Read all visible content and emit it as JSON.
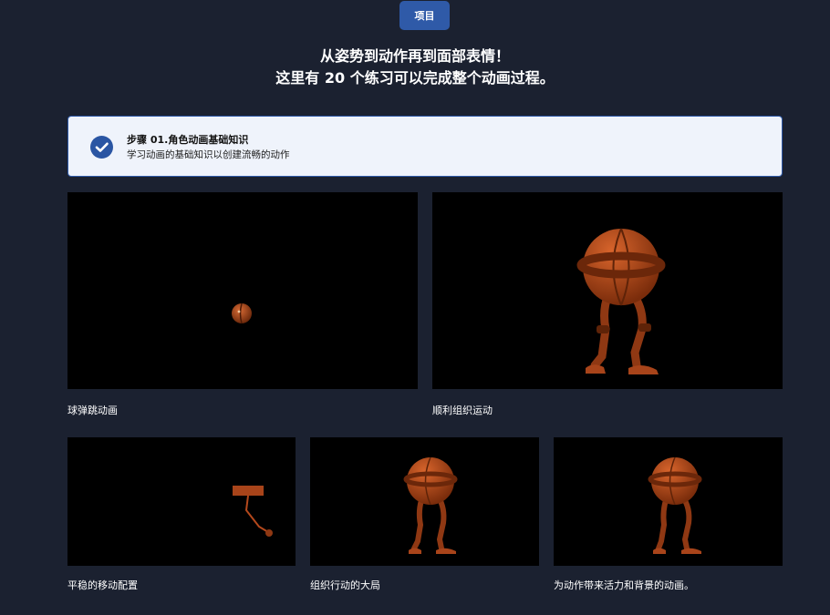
{
  "top_tab": {
    "label": "项目"
  },
  "headline": {
    "line1": "从姿势到动作再到面部表情！",
    "line2": "这里有 20 个练习可以完成整个动画过程。"
  },
  "step": {
    "title": "步骤 01.角色动画基础知识",
    "subtitle": "学习动画的基础知识以创建流畅的动作"
  },
  "lessons": [
    {
      "caption": "球弹跳动画"
    },
    {
      "caption": "顺利组织运动"
    },
    {
      "caption": "平稳的移动配置"
    },
    {
      "caption": "组织行动的大局"
    },
    {
      "caption": "为动作带来活力和背景的动画。"
    }
  ],
  "colors": {
    "background": "#1b2130",
    "accent": "#2f5aa8",
    "card": "#eff3fb",
    "character": "#b4481c"
  }
}
